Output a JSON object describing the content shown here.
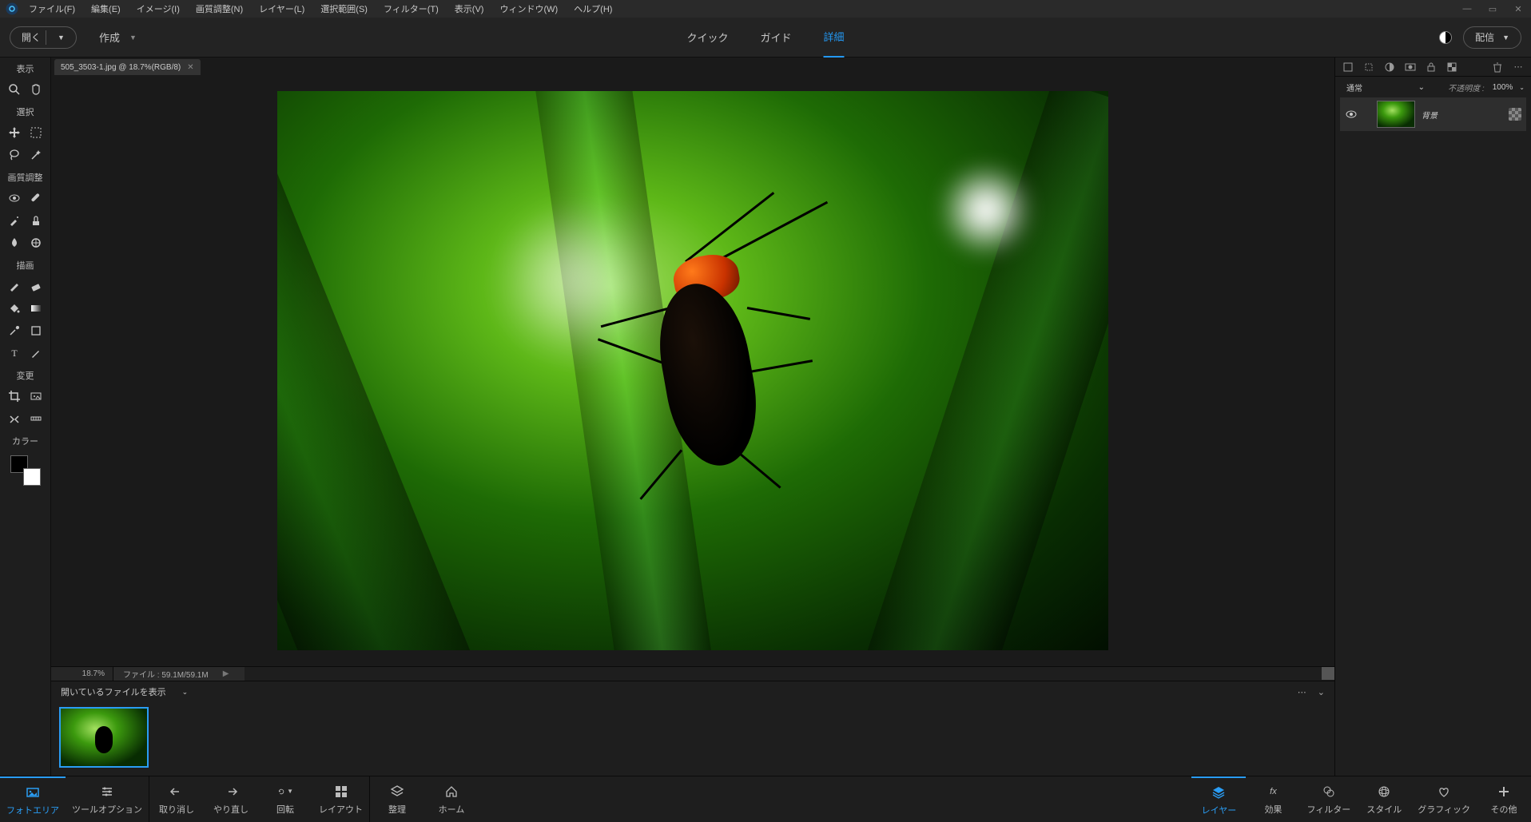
{
  "menubar": {
    "items": [
      "ファイル(F)",
      "編集(E)",
      "イメージ(I)",
      "画質調整(N)",
      "レイヤー(L)",
      "選択範囲(S)",
      "フィルター(T)",
      "表示(V)",
      "ウィンドウ(W)",
      "ヘルプ(H)"
    ]
  },
  "secondbar": {
    "open": "開く",
    "create": "作成",
    "tabs": [
      "クイック",
      "ガイド",
      "詳細"
    ],
    "active_tab": 2,
    "distribute": "配信"
  },
  "document": {
    "tab_label": "505_3503-1.jpg @ 18.7%(RGB/8)",
    "zoom": "18.7%",
    "file_status": "ファイル : 59.1M/59.1M"
  },
  "toolbox": {
    "groups": [
      "表示",
      "選択",
      "画質調整",
      "描画",
      "変更",
      "カラー"
    ]
  },
  "photo_bin": {
    "header": "開いているファイルを表示"
  },
  "layers": {
    "blend_mode": "通常",
    "opacity_label": "不透明度 :",
    "opacity_value": "100%",
    "items": [
      {
        "name": "背景"
      }
    ]
  },
  "bottom": {
    "left": [
      "フォトエリア",
      "ツールオプション"
    ],
    "left_active": 0,
    "mid": [
      "取り消し",
      "やり直し",
      "回転",
      "レイアウト"
    ],
    "mid2": [
      "整理",
      "ホーム"
    ],
    "right": [
      "レイヤー",
      "効果",
      "フィルター",
      "スタイル",
      "グラフィック",
      "その他"
    ],
    "right_active": 0
  }
}
